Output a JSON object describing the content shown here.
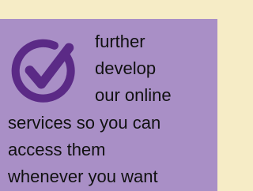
{
  "message": {
    "icon": "check-circle-icon",
    "colors": {
      "background_top": "#f6ecc6",
      "card_background": "#a98fc6",
      "icon_color": "#5b2a86",
      "text_color": "#111111"
    },
    "lines": [
      "further",
      "develop",
      "our online",
      "services so you can",
      "access them",
      "whenever you want"
    ]
  }
}
